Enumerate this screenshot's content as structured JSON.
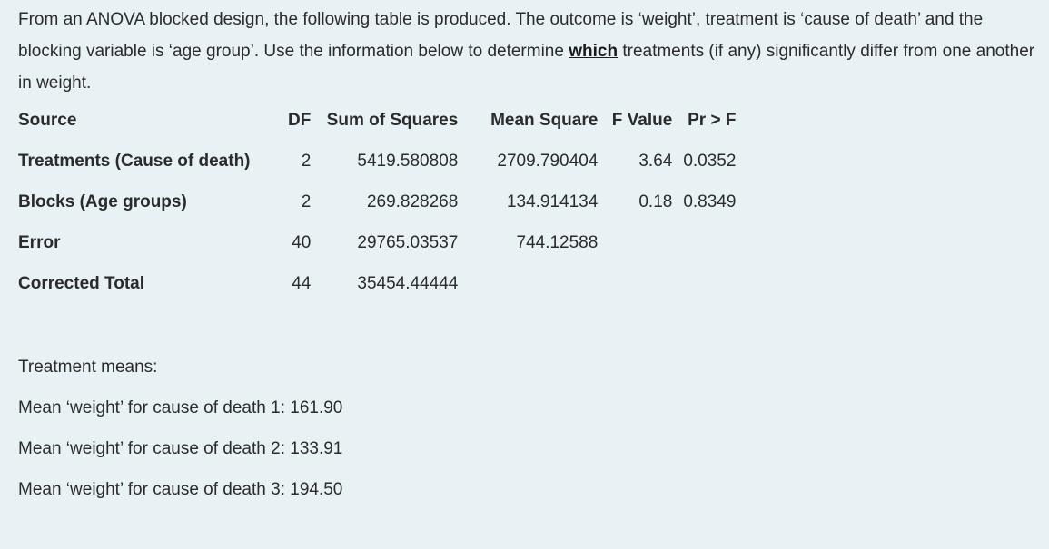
{
  "question": {
    "part1": "From an ANOVA blocked design, the following table is produced. The outcome is ‘weight’, treatment is ‘cause of death’ and the blocking variable is ‘age group’. Use the information below to determine ",
    "emphasis": "which",
    "part2": " treatments (if any) significantly differ from one another in weight."
  },
  "anova_table": {
    "headers": {
      "source": "Source",
      "df": "DF",
      "ss": "Sum of Squares",
      "ms": "Mean Square",
      "f": "F Value",
      "p": "Pr > F"
    },
    "rows": [
      {
        "source": "Treatments (Cause of death)",
        "df": "2",
        "ss": "5419.580808",
        "ms": "2709.790404",
        "f": "3.64",
        "p": "0.0352"
      },
      {
        "source": "Blocks (Age groups)",
        "df": "2",
        "ss": "269.828268",
        "ms": "134.914134",
        "f": "0.18",
        "p": "0.8349"
      },
      {
        "source": "Error",
        "df": "40",
        "ss": "29765.03537",
        "ms": "744.12588",
        "f": "",
        "p": ""
      },
      {
        "source": "Corrected Total",
        "df": "44",
        "ss": "35454.44444",
        "ms": "",
        "f": "",
        "p": ""
      }
    ]
  },
  "treatment_means": {
    "heading": "Treatment means:",
    "items": [
      "Mean ‘weight’ for cause of death 1: 161.90",
      "Mean ‘weight’ for cause of death 2: 133.91",
      "Mean ‘weight’ for cause of death 3: 194.50"
    ]
  }
}
